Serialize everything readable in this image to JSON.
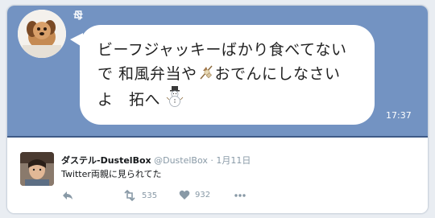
{
  "chat": {
    "sender_name": "母",
    "message_line1": "ビーフジャッキーばかり食べてない",
    "message_line2_text": "で 和風弁当や",
    "message_line2_tail": "おでんにしなさい",
    "message_line3_text": "よ　拓へ",
    "time": "17:37",
    "background_color": "#7393c2",
    "emojis": [
      "oden-emoji",
      "snowman-emoji"
    ]
  },
  "tweet": {
    "display_name": "ダステル-DustelBox",
    "handle": "@DustelBox",
    "separator": "·",
    "date": "1月11日",
    "text": "Twitter両親に見られてた",
    "retweet_count": "535",
    "like_count": "932"
  }
}
